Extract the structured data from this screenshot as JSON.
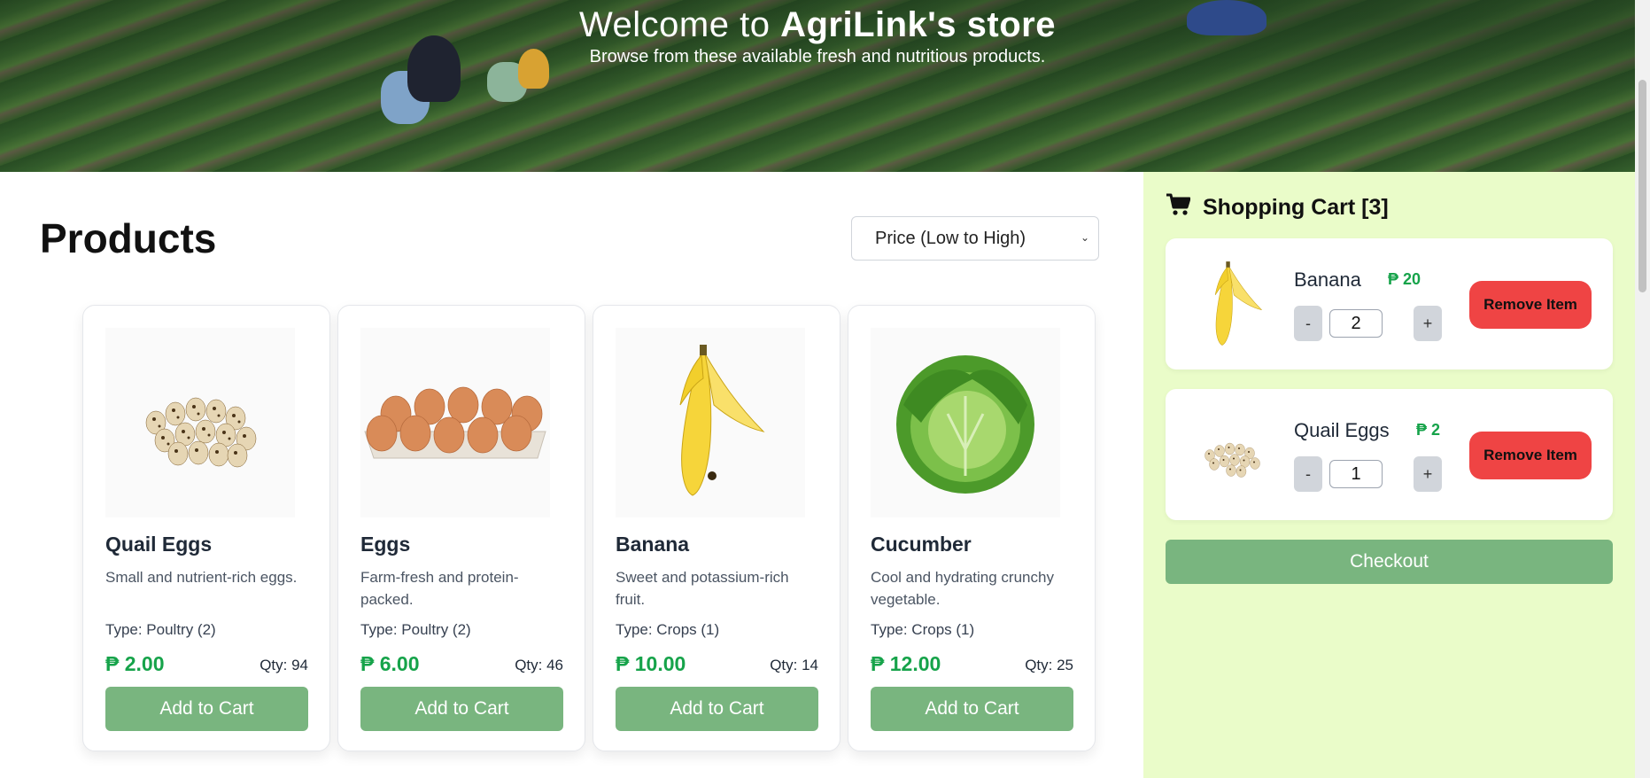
{
  "hero": {
    "title_prefix": "Welcome to ",
    "title_brand": "AgriLink's store",
    "subtitle": "Browse from these available fresh and nutritious products."
  },
  "products_section": {
    "title": "Products",
    "sort": {
      "selected": "Price (Low to High)"
    },
    "items": [
      {
        "name": "Quail Eggs",
        "description": "Small and nutrient-rich eggs.",
        "type": "Type: Poultry (2)",
        "price": "₱ 2.00",
        "qty": "Qty: 94",
        "button": "Add to Cart",
        "image_icon": "quail-eggs-image"
      },
      {
        "name": "Eggs",
        "description": "Farm-fresh and protein-packed.",
        "type": "Type: Poultry (2)",
        "price": "₱ 6.00",
        "qty": "Qty: 46",
        "button": "Add to Cart",
        "image_icon": "eggs-image"
      },
      {
        "name": "Banana",
        "description": "Sweet and potassium-rich fruit.",
        "type": "Type: Crops (1)",
        "price": "₱ 10.00",
        "qty": "Qty: 14",
        "button": "Add to Cart",
        "image_icon": "banana-image"
      },
      {
        "name": "Cucumber",
        "description": "Cool and hydrating crunchy vegetable.",
        "type": "Type: Crops (1)",
        "price": "₱ 12.00",
        "qty": "Qty: 25",
        "button": "Add to Cart",
        "image_icon": "cabbage-image"
      }
    ]
  },
  "cart": {
    "title": "Shopping Cart [3]",
    "icon": "cart-icon",
    "items": [
      {
        "name": "Banana",
        "price": "₱ 20",
        "minus": "-",
        "quantity": "2",
        "plus": "+",
        "remove": "Remove Item"
      },
      {
        "name": "Quail Eggs",
        "price": "₱ 2",
        "minus": "-",
        "quantity": "1",
        "plus": "+",
        "remove": "Remove Item"
      }
    ],
    "checkout": "Checkout"
  },
  "colors": {
    "accent_green": "#79b57f",
    "price_green": "#16a34a",
    "remove_red": "#ef4444",
    "cart_bg": "#eafcc9"
  }
}
